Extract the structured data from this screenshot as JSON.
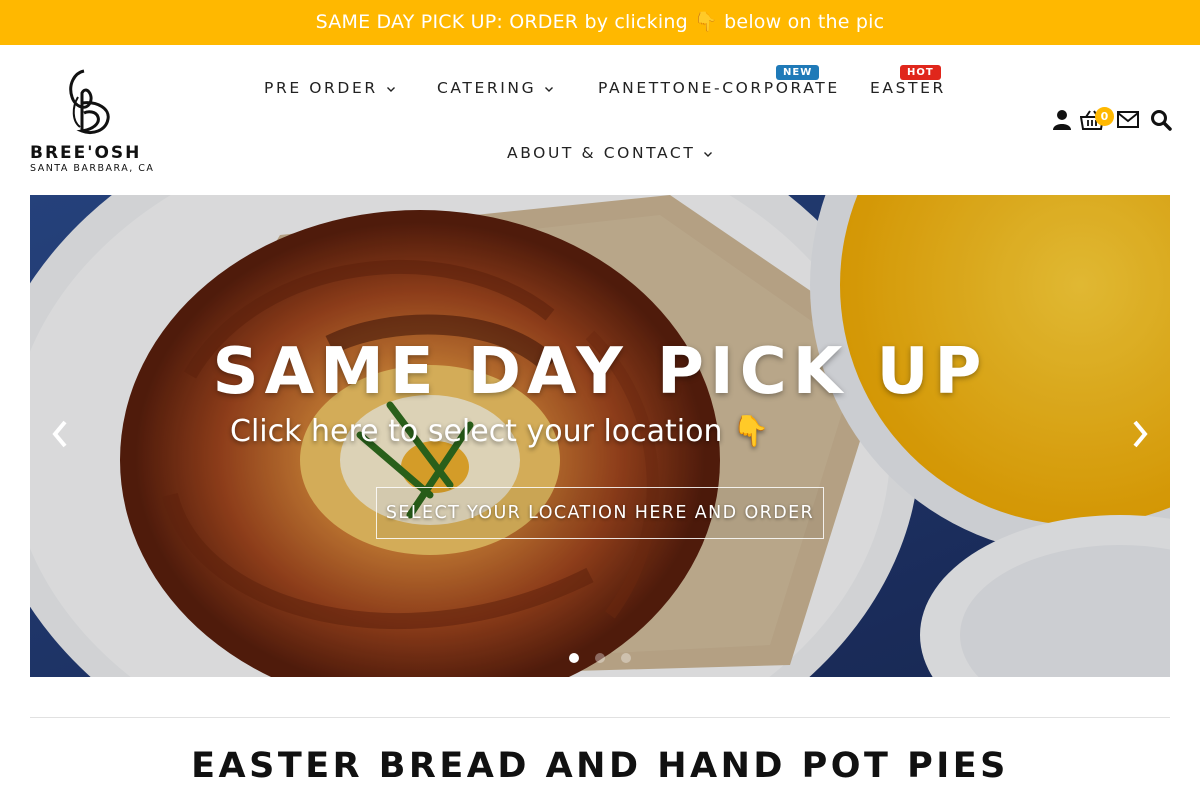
{
  "promo_bar": {
    "text": "SAME DAY PICK UP: ORDER by clicking 👇 below on the pic"
  },
  "logo": {
    "monogram": "B",
    "name": "BREE'OSH",
    "location": "SANTA BARBARA, CA"
  },
  "nav": {
    "items": [
      {
        "label": "PRE ORDER",
        "has_dropdown": true
      },
      {
        "label": "CATERING",
        "has_dropdown": true
      },
      {
        "label": "PANETTONE-CORPORATE",
        "has_dropdown": false,
        "badge": "NEW"
      },
      {
        "label": "EASTER",
        "has_dropdown": false,
        "badge": "HOT"
      },
      {
        "label": "ABOUT & CONTACT",
        "has_dropdown": true
      }
    ]
  },
  "header_icons": {
    "account": "user-icon",
    "cart": "basket-icon",
    "cart_count": "0",
    "mail": "envelope-icon",
    "search": "search-icon"
  },
  "hero": {
    "title": "SAME DAY PICK UP",
    "subtitle": "Click here to select your location 👇",
    "cta_label": "SELECT YOUR LOCATION HERE AND ORDER",
    "prev_icon": "chevron-left-icon",
    "next_icon": "chevron-right-icon",
    "slide_count": 3,
    "active_slide": 1
  },
  "section": {
    "title": "EASTER BREAD AND HAND POT PIES"
  },
  "colors": {
    "accent": "#ffb800",
    "badge_new": "#1f7ab8",
    "badge_hot": "#e0261b",
    "text": "#222222"
  }
}
